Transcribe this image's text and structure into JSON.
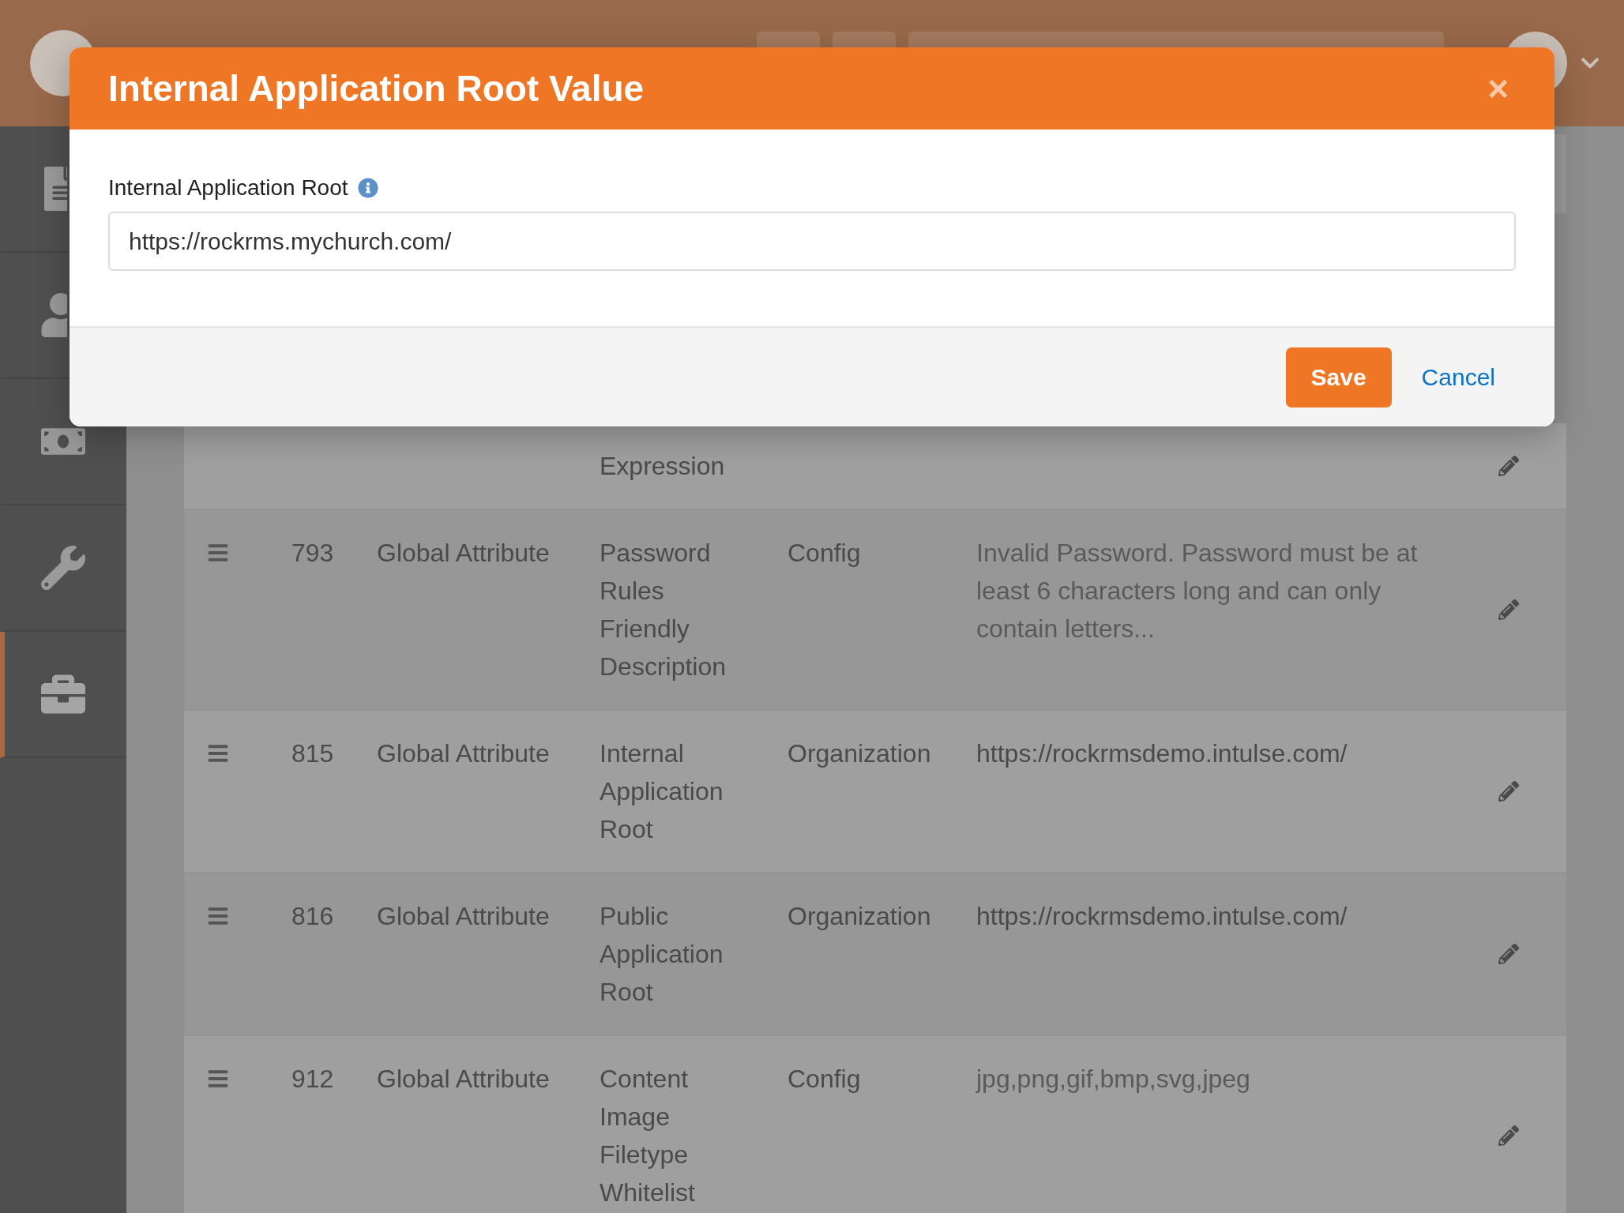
{
  "sidebar": {
    "items": [
      {
        "selected": false
      },
      {
        "selected": false
      },
      {
        "selected": false
      },
      {
        "selected": false
      },
      {
        "selected": true
      }
    ]
  },
  "table": {
    "rows": [
      {
        "name": "Expression"
      },
      {
        "id": "793",
        "type": "Global Attribute",
        "name": "Password Rules Friendly Description",
        "category": "Config",
        "value": "Invalid Password. Password must be at least 6 characters long and can only contain letters..."
      },
      {
        "id": "815",
        "type": "Global Attribute",
        "name": "Internal Application Root",
        "category": "Organization",
        "value": "https://rockrmsdemo.intulse.com/"
      },
      {
        "id": "816",
        "type": "Global Attribute",
        "name": "Public Application Root",
        "category": "Organization",
        "value": "https://rockrmsdemo.intulse.com/"
      },
      {
        "id": "912",
        "type": "Global Attribute",
        "name": "Content Image Filetype Whitelist",
        "category": "Config",
        "value": "jpg,png,gif,bmp,svg,jpeg"
      }
    ]
  },
  "modal": {
    "title": "Internal Application Root Value",
    "close": "×",
    "field": {
      "label": "Internal Application Root",
      "value": "https://rockrms.mychurch.com/"
    },
    "save": "Save",
    "cancel": "Cancel"
  }
}
